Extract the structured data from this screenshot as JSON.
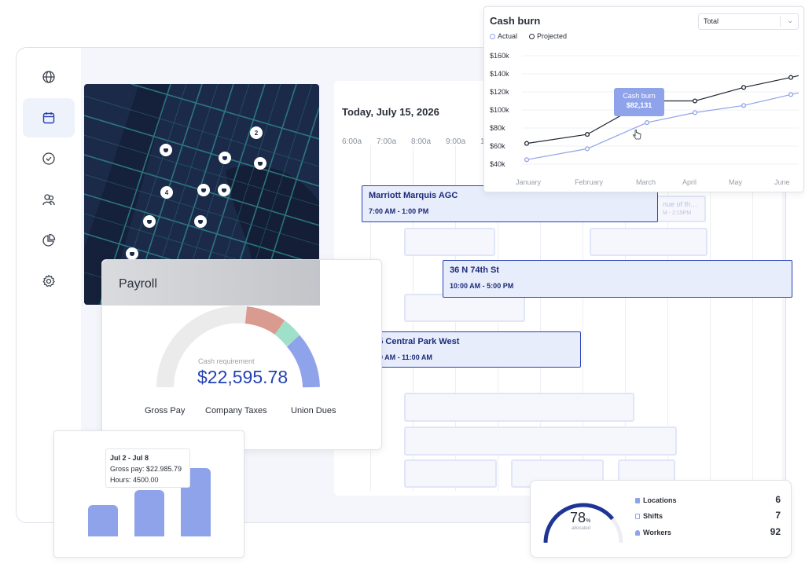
{
  "schedule": {
    "date": "Today, July 15, 2026",
    "times": [
      "6:00a",
      "7:00a",
      "8:00a",
      "9:00a",
      "1"
    ],
    "events": [
      {
        "name": "Marriott Marquis AGC",
        "time": "7:00 AM - 1:00 PM"
      },
      {
        "name": "36 N 74th St",
        "time": "10:00 AM - 5:00 PM"
      },
      {
        "name": "225 Central Park West",
        "time": "7:00 AM - 11:00 AM"
      }
    ],
    "faded_event": {
      "name": "nue of th…",
      "time": "M - 2:15PM"
    }
  },
  "map": {
    "pins": [
      {
        "label": "2"
      },
      {
        "label": "4"
      }
    ]
  },
  "payroll": {
    "title": "Payroll",
    "cash_label": "Cash requirement",
    "cash_value": "$22,595.78",
    "legend": [
      "Gross Pay",
      "Company Taxes",
      "Union Dues"
    ],
    "colors": {
      "gross": "#ebebeb",
      "taxes": "#d99a8f",
      "teal": "#9fe0c8",
      "union": "#8fa3ea"
    }
  },
  "hours_card": {
    "tooltip_title": "Jul 2 - Jul 8",
    "tooltip_gross": "Gross pay: $22.985.79",
    "tooltip_hours": "Hours: 4500.00",
    "bar_color": "#8fa3ea"
  },
  "cash_burn": {
    "title": "Cash burn",
    "select_value": "Total",
    "legend_actual": "Actual",
    "legend_projected": "Projected",
    "tooltip_label": "Cash burn",
    "tooltip_value": "$82,131"
  },
  "chart_data": {
    "type": "line",
    "title": "Cash burn",
    "categories": [
      "January",
      "February",
      "March",
      "April",
      "May",
      "June"
    ],
    "yticks": [
      "$160k",
      "$140k",
      "$120k",
      "$100k",
      "$80k",
      "$60k",
      "$40k"
    ],
    "ylim": [
      40,
      160
    ],
    "grid": true,
    "legend_placement": "top-left",
    "series": [
      {
        "name": "Actual",
        "color": "#8fa3ea",
        "x": [
          0,
          1,
          2,
          3,
          4,
          5
        ],
        "values": [
          45,
          57,
          86,
          97,
          105,
          117
        ]
      },
      {
        "name": "Projected",
        "color": "#1f2430",
        "x": [
          0,
          1,
          2,
          3,
          4,
          5
        ],
        "values": [
          63,
          73,
          110,
          110,
          125,
          136
        ]
      }
    ]
  },
  "allocation": {
    "percent": "78",
    "percent_sign": "%",
    "label": "allocated",
    "fraction": 0.78,
    "stats": [
      {
        "label": "Locations",
        "value": "6"
      },
      {
        "label": "Shifts",
        "value": "7"
      },
      {
        "label": "Workers",
        "value": "92"
      }
    ]
  }
}
